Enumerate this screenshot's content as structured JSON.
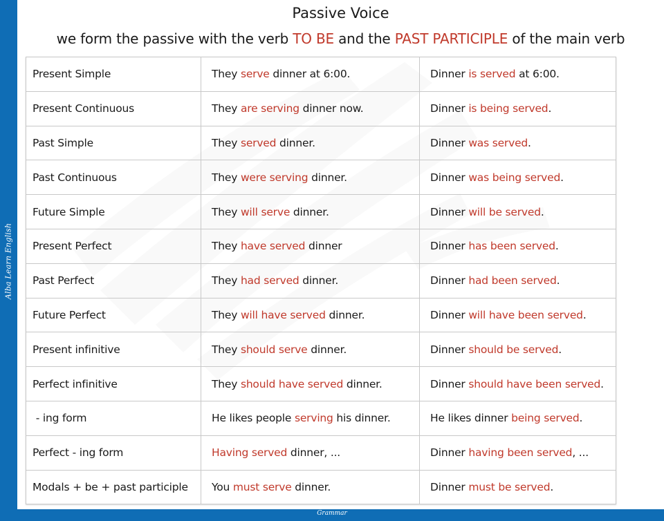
{
  "brand": {
    "side_label": "Alba Learn English",
    "footer_label": "Grammar",
    "accent_color": "#0f6db5",
    "highlight_color": "#c0392b"
  },
  "header": {
    "title": "Passive Voice",
    "subtitle_parts": [
      {
        "text": "we form the passive with the verb ",
        "hl": false
      },
      {
        "text": "TO BE",
        "hl": true
      },
      {
        "text": " and the ",
        "hl": false
      },
      {
        "text": "PAST PARTICIPLE",
        "hl": true
      },
      {
        "text": " of the main verb",
        "hl": false
      }
    ]
  },
  "table": {
    "rows": [
      {
        "tense": "Present Simple",
        "active": [
          {
            "t": "They ",
            "h": false
          },
          {
            "t": "serve",
            "h": true
          },
          {
            "t": " dinner at 6:00.",
            "h": false
          }
        ],
        "passive": [
          {
            "t": "Dinner ",
            "h": false
          },
          {
            "t": "is served",
            "h": true
          },
          {
            "t": " at 6:00.",
            "h": false
          }
        ]
      },
      {
        "tense": "Present Continuous",
        "active": [
          {
            "t": "They ",
            "h": false
          },
          {
            "t": "are serving",
            "h": true
          },
          {
            "t": " dinner now.",
            "h": false
          }
        ],
        "passive": [
          {
            "t": "Dinner ",
            "h": false
          },
          {
            "t": "is being served",
            "h": true
          },
          {
            "t": ".",
            "h": false
          }
        ]
      },
      {
        "tense": "Past Simple",
        "active": [
          {
            "t": "They ",
            "h": false
          },
          {
            "t": "served",
            "h": true
          },
          {
            "t": " dinner.",
            "h": false
          }
        ],
        "passive": [
          {
            "t": "Dinner ",
            "h": false
          },
          {
            "t": "was served",
            "h": true
          },
          {
            "t": ".",
            "h": false
          }
        ]
      },
      {
        "tense": "Past Continuous",
        "active": [
          {
            "t": "They ",
            "h": false
          },
          {
            "t": "were serving",
            "h": true
          },
          {
            "t": " dinner.",
            "h": false
          }
        ],
        "passive": [
          {
            "t": "Dinner ",
            "h": false
          },
          {
            "t": "was being served",
            "h": true
          },
          {
            "t": ".",
            "h": false
          }
        ]
      },
      {
        "tense": "Future Simple",
        "active": [
          {
            "t": "They ",
            "h": false
          },
          {
            "t": "will serve",
            "h": true
          },
          {
            "t": " dinner.",
            "h": false
          }
        ],
        "passive": [
          {
            "t": "Dinner ",
            "h": false
          },
          {
            "t": "will be served",
            "h": true
          },
          {
            "t": ".",
            "h": false
          }
        ]
      },
      {
        "tense": "Present Perfect",
        "active": [
          {
            "t": "They ",
            "h": false
          },
          {
            "t": "have served",
            "h": true
          },
          {
            "t": " dinner",
            "h": false
          }
        ],
        "passive": [
          {
            "t": "Dinner ",
            "h": false
          },
          {
            "t": "has been served",
            "h": true
          },
          {
            "t": ".",
            "h": false
          }
        ]
      },
      {
        "tense": "Past Perfect",
        "active": [
          {
            "t": "They ",
            "h": false
          },
          {
            "t": "had served",
            "h": true
          },
          {
            "t": " dinner.",
            "h": false
          }
        ],
        "passive": [
          {
            "t": "Dinner ",
            "h": false
          },
          {
            "t": "had been served",
            "h": true
          },
          {
            "t": ".",
            "h": false
          }
        ]
      },
      {
        "tense": "Future Perfect",
        "active": [
          {
            "t": "They ",
            "h": false
          },
          {
            "t": "will have served",
            "h": true
          },
          {
            "t": " dinner.",
            "h": false
          }
        ],
        "passive": [
          {
            "t": "Dinner ",
            "h": false
          },
          {
            "t": "will have been served",
            "h": true
          },
          {
            "t": ".",
            "h": false
          }
        ]
      },
      {
        "tense": "Present infinitive",
        "active": [
          {
            "t": "They ",
            "h": false
          },
          {
            "t": "should serve",
            "h": true
          },
          {
            "t": " dinner.",
            "h": false
          }
        ],
        "passive": [
          {
            "t": "Dinner ",
            "h": false
          },
          {
            "t": "should be served",
            "h": true
          },
          {
            "t": ".",
            "h": false
          }
        ]
      },
      {
        "tense": "Perfect infinitive",
        "active": [
          {
            "t": "They ",
            "h": false
          },
          {
            "t": "should have served",
            "h": true
          },
          {
            "t": " dinner.",
            "h": false
          }
        ],
        "passive": [
          {
            "t": "Dinner ",
            "h": false
          },
          {
            "t": "should have been served",
            "h": true
          },
          {
            "t": ".",
            "h": false
          }
        ]
      },
      {
        "tense": " - ing form",
        "active": [
          {
            "t": "He likes people ",
            "h": false
          },
          {
            "t": "serving",
            "h": true
          },
          {
            "t": " his dinner.",
            "h": false
          }
        ],
        "passive": [
          {
            "t": "He likes dinner ",
            "h": false
          },
          {
            "t": "being served",
            "h": true
          },
          {
            "t": ".",
            "h": false
          }
        ]
      },
      {
        "tense": "Perfect - ing form",
        "active": [
          {
            "t": "Having served",
            "h": true
          },
          {
            "t": " dinner, ...",
            "h": false
          }
        ],
        "passive": [
          {
            "t": "Dinner ",
            "h": false
          },
          {
            "t": "having been served",
            "h": true
          },
          {
            "t": ", ...",
            "h": false
          }
        ]
      },
      {
        "tense": "Modals + be + past participle",
        "active": [
          {
            "t": "You ",
            "h": false
          },
          {
            "t": "must serve",
            "h": true
          },
          {
            "t": " dinner.",
            "h": false
          }
        ],
        "passive": [
          {
            "t": "Dinner ",
            "h": false
          },
          {
            "t": "must be served",
            "h": true
          },
          {
            "t": ".",
            "h": false
          }
        ]
      }
    ]
  }
}
